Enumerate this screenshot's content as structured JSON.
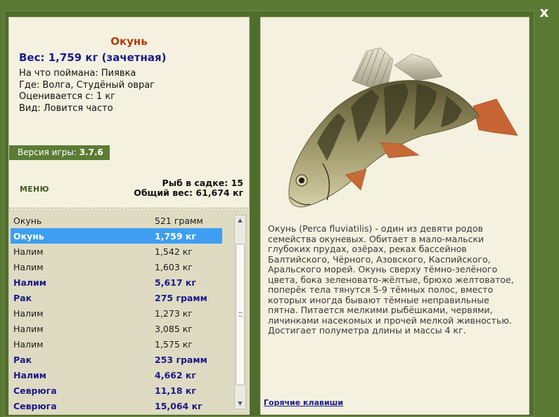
{
  "close_label": "x",
  "fish": {
    "name": "Окунь",
    "weight_line": "Вес: 1,759 кг (зачетная)",
    "bait_line": "На что поймана: Пиявка",
    "place_line": "Где: Волга, Студёный овраг",
    "rated_line": "Оценивается с: 1 кг",
    "kind_line": "Вид: Ловится часто"
  },
  "version": {
    "label": "Версия игры: ",
    "value": "3.7.6"
  },
  "menu_label": "МЕНЮ",
  "stats": {
    "keepnet_line": "Рыб в садке: 15",
    "total_line": "Общий вес: 61,674 кг"
  },
  "catch_list": [
    {
      "name": "Окунь",
      "weight": "521 грамм",
      "style": "normal"
    },
    {
      "name": "Окунь",
      "weight": "1,759 кг",
      "style": "selected"
    },
    {
      "name": "Налим",
      "weight": "1,542 кг",
      "style": "normal"
    },
    {
      "name": "Налим",
      "weight": "1,603 кг",
      "style": "normal"
    },
    {
      "name": "Налим",
      "weight": "5,617 кг",
      "style": "bold"
    },
    {
      "name": "Рак",
      "weight": "275 грамм",
      "style": "bold"
    },
    {
      "name": "Налим",
      "weight": "1,273 кг",
      "style": "normal"
    },
    {
      "name": "Налим",
      "weight": "3,085 кг",
      "style": "normal"
    },
    {
      "name": "Налим",
      "weight": "1,575 кг",
      "style": "normal"
    },
    {
      "name": "Рак",
      "weight": "253 грамм",
      "style": "bold"
    },
    {
      "name": "Налим",
      "weight": "4,662 кг",
      "style": "bold"
    },
    {
      "name": "Севрюга",
      "weight": "11,18 кг",
      "style": "bold"
    },
    {
      "name": "Севрюга",
      "weight": "15,064 кг",
      "style": "bold"
    }
  ],
  "description": "Окунь (Perca fluviatilis) - один из девяти родов семейства окуневых. Обитает в мало-мальски глубоких прудах, озёрах, реках бассейнов Балтийского, Чёрного, Азовского, Каспийского, Аральского морей. Окунь сверху тёмно-зелёного цвета, бока зеленовато-жёлтые, брюхо желтоватое, поперёк тела тянутся 5-9 тёмных полос, вместо которых иногда бывают тёмные неправильные пятна. Питается мелкими рыбёшками, червями, личинками насекомых и прочей мелкой живностью. Достигает полуметра длины и массы 4 кг.",
  "hotkeys_label": "Горячие клавиши",
  "colors": {
    "background": "#5a7a34",
    "panel": "#f4f1e0",
    "list_bg": "#dedbc2",
    "title": "#b23c0b",
    "accent_text": "#1a1a8c",
    "selection": "#3d9ef2"
  }
}
